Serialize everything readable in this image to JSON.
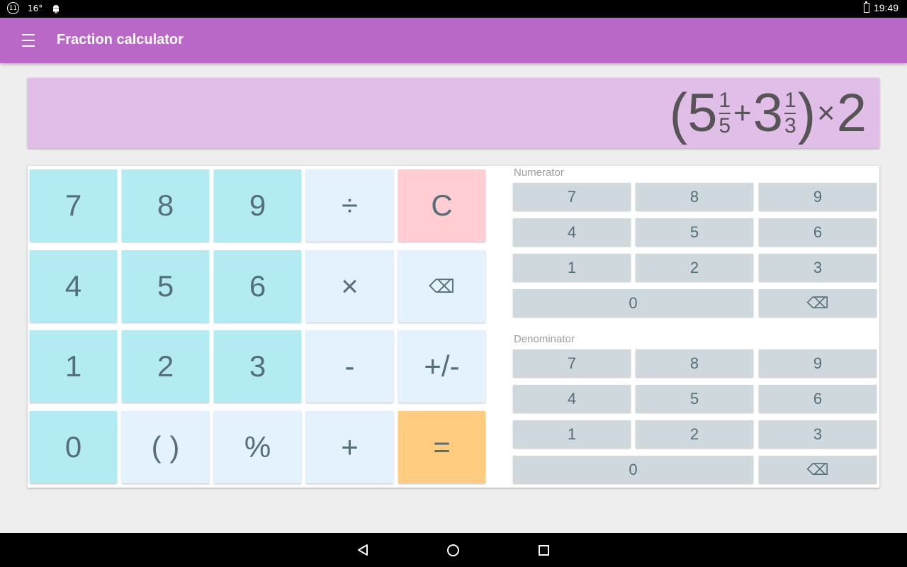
{
  "status_bar": {
    "notification_badge": "11",
    "temperature": "16°",
    "time": "19:49",
    "icons": [
      "notification-count-icon",
      "android-icon",
      "battery-charging-icon"
    ]
  },
  "app_bar": {
    "title": "Fraction calculator",
    "menu_icon": "hamburger-menu-icon"
  },
  "display": {
    "open_paren": "(",
    "whole1": "5",
    "frac1": {
      "num": "1",
      "den": "5"
    },
    "op1": "+",
    "whole2": "3",
    "frac2": {
      "num": "1",
      "den": "3"
    },
    "close_paren": ")",
    "op2": "×",
    "number3": "2"
  },
  "main_keypad": {
    "row1": [
      "7",
      "8",
      "9",
      "÷",
      "C"
    ],
    "row2": [
      "4",
      "5",
      "6",
      "×",
      "⌫"
    ],
    "row3": [
      "1",
      "2",
      "3",
      "-",
      "+/-"
    ],
    "row4": [
      "0",
      "( )",
      "%",
      "+",
      "="
    ]
  },
  "numerator": {
    "label": "Numerator",
    "row1": [
      "7",
      "8",
      "9"
    ],
    "row2": [
      "4",
      "5",
      "6"
    ],
    "row3": [
      "1",
      "2",
      "3"
    ],
    "row4": [
      "0",
      "⌫"
    ]
  },
  "denominator": {
    "label": "Denominator",
    "row1": [
      "7",
      "8",
      "9"
    ],
    "row2": [
      "4",
      "5",
      "6"
    ],
    "row3": [
      "1",
      "2",
      "3"
    ],
    "row4": [
      "0",
      "⌫"
    ]
  },
  "colors": {
    "app_bar": "#ba68c8",
    "display": "#e1bee7",
    "digit_key": "#b2ebf2",
    "operator_key": "#e3f2fd",
    "clear_key": "#ffcdd2",
    "equals_key": "#ffcc80",
    "small_key": "#cfd8dc"
  },
  "nav_bar": {
    "icons": [
      "back-icon",
      "home-icon",
      "recents-icon"
    ]
  }
}
